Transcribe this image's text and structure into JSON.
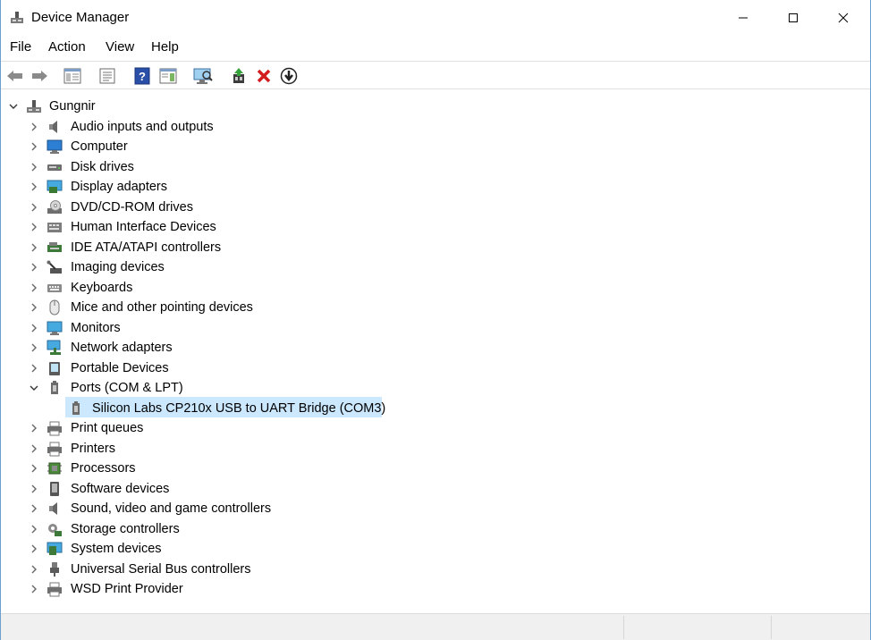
{
  "window": {
    "title": "Device Manager",
    "icon": "device-manager-icon",
    "controls": [
      "minimize-icon",
      "maximize-icon",
      "close-icon"
    ]
  },
  "menu": {
    "items": [
      "File",
      "Action",
      "View",
      "Help"
    ]
  },
  "toolbar": {
    "buttons": [
      "back-arrow-icon",
      "forward-arrow-icon",
      "show-hide-console-tree-icon",
      "properties-icon",
      "help-icon",
      "action-pane-icon",
      "scan-hardware-changes-icon",
      "update-driver-icon",
      "uninstall-device-icon",
      "disable-device-icon"
    ]
  },
  "tree": {
    "root": "Gungnir",
    "categories": [
      {
        "label": "Audio inputs and outputs",
        "icon": "speaker-icon"
      },
      {
        "label": "Computer",
        "icon": "computer-icon"
      },
      {
        "label": "Disk drives",
        "icon": "disk-drive-icon"
      },
      {
        "label": "Display adapters",
        "icon": "display-adapter-icon"
      },
      {
        "label": "DVD/CD-ROM drives",
        "icon": "optical-drive-icon"
      },
      {
        "label": "Human Interface Devices",
        "icon": "hid-icon"
      },
      {
        "label": "IDE ATA/ATAPI controllers",
        "icon": "ide-controller-icon"
      },
      {
        "label": "Imaging devices",
        "icon": "imaging-device-icon"
      },
      {
        "label": "Keyboards",
        "icon": "keyboard-icon"
      },
      {
        "label": "Mice and other pointing devices",
        "icon": "mouse-icon"
      },
      {
        "label": "Monitors",
        "icon": "monitor-icon"
      },
      {
        "label": "Network adapters",
        "icon": "network-adapter-icon"
      },
      {
        "label": "Portable Devices",
        "icon": "portable-device-icon"
      },
      {
        "label": "Ports (COM & LPT)",
        "icon": "port-icon",
        "expanded": true,
        "children": [
          {
            "label": "Silicon Labs CP210x USB to UART Bridge (COM3)",
            "icon": "port-icon",
            "selected": true
          }
        ]
      },
      {
        "label": "Print queues",
        "icon": "printer-icon"
      },
      {
        "label": "Printers",
        "icon": "printer-icon"
      },
      {
        "label": "Processors",
        "icon": "processor-icon"
      },
      {
        "label": "Software devices",
        "icon": "software-device-icon"
      },
      {
        "label": "Sound, video and game controllers",
        "icon": "speaker-icon"
      },
      {
        "label": "Storage controllers",
        "icon": "storage-controller-icon"
      },
      {
        "label": "System devices",
        "icon": "system-device-icon"
      },
      {
        "label": "Universal Serial Bus controllers",
        "icon": "usb-icon"
      },
      {
        "label": "WSD Print Provider",
        "icon": "printer-icon"
      }
    ]
  },
  "colors": {
    "selection": "#cce8ff",
    "border": "#6f9fcf"
  }
}
